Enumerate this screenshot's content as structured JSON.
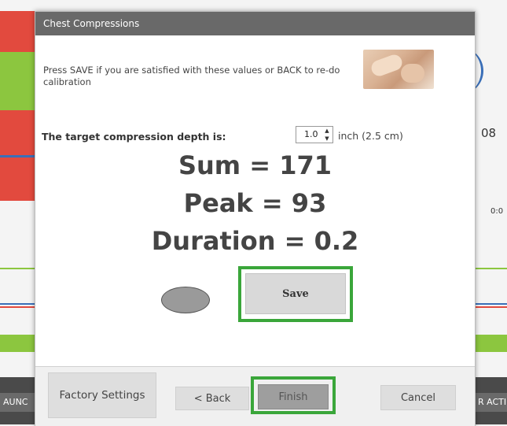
{
  "background": {
    "right_value": "08",
    "right_time": "0:0",
    "bottom_left_label": "AUNC",
    "bottom_right_label": "R ACTI"
  },
  "dialog": {
    "title": "Chest Compressions",
    "instruction": "Press SAVE if you are satisfied with these values or BACK to re-do calibration",
    "depth_label": "The target compression depth is:",
    "depth_value": "1.0",
    "depth_unit": "inch (2.5 cm)",
    "sum_text": "Sum = 171",
    "peak_text": "Peak = 93",
    "duration_text": "Duration = 0.2",
    "save_label": "Save"
  },
  "footer": {
    "factory_label": "Factory Settings",
    "back_label": "< Back",
    "finish_label": "Finish",
    "cancel_label": "Cancel"
  },
  "colors": {
    "titlebar": "#696969",
    "highlight": "#3aa63a",
    "bg_red": "#e24a3e",
    "bg_green": "#8cc63f"
  }
}
